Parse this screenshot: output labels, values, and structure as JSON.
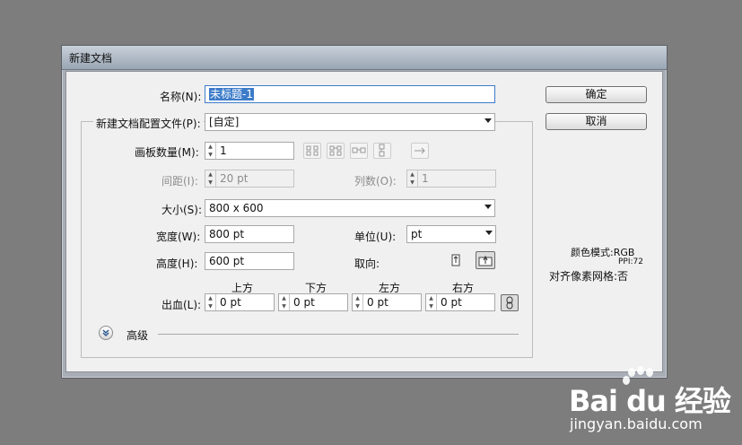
{
  "dialog": {
    "title": "新建文档",
    "name_label": "名称(N):",
    "name_value": "未标题-1",
    "profile_label": "新建文档配置文件(P):",
    "profile_value": "[自定]",
    "artboards_label": "画板数量(M):",
    "artboards_value": "1",
    "spacing_label": "间距(I):",
    "spacing_value": "20 pt",
    "columns_label": "列数(O):",
    "columns_value": "1",
    "size_label": "大小(S):",
    "size_value": "800 x 600",
    "width_label": "宽度(W):",
    "width_value": "800 pt",
    "units_label": "单位(U):",
    "units_value": "pt",
    "height_label": "高度(H):",
    "height_value": "600 pt",
    "orientation_label": "取向:",
    "bleed_label": "出血(L):",
    "bleed": {
      "top_label": "上方",
      "top_value": "0 pt",
      "bottom_label": "下方",
      "bottom_value": "0 pt",
      "left_label": "左方",
      "left_value": "0 pt",
      "right_label": "右方",
      "right_value": "0 pt"
    },
    "advanced_label": "高级",
    "ok_label": "确定",
    "cancel_label": "取消",
    "info": {
      "color_mode": "颜色模式:RGB",
      "ppi": "PPI:72",
      "pixel_grid": "对齐像素网格:否"
    }
  },
  "watermark": {
    "brand": "Bai du 经验",
    "url": "jingyan.baidu.com"
  }
}
